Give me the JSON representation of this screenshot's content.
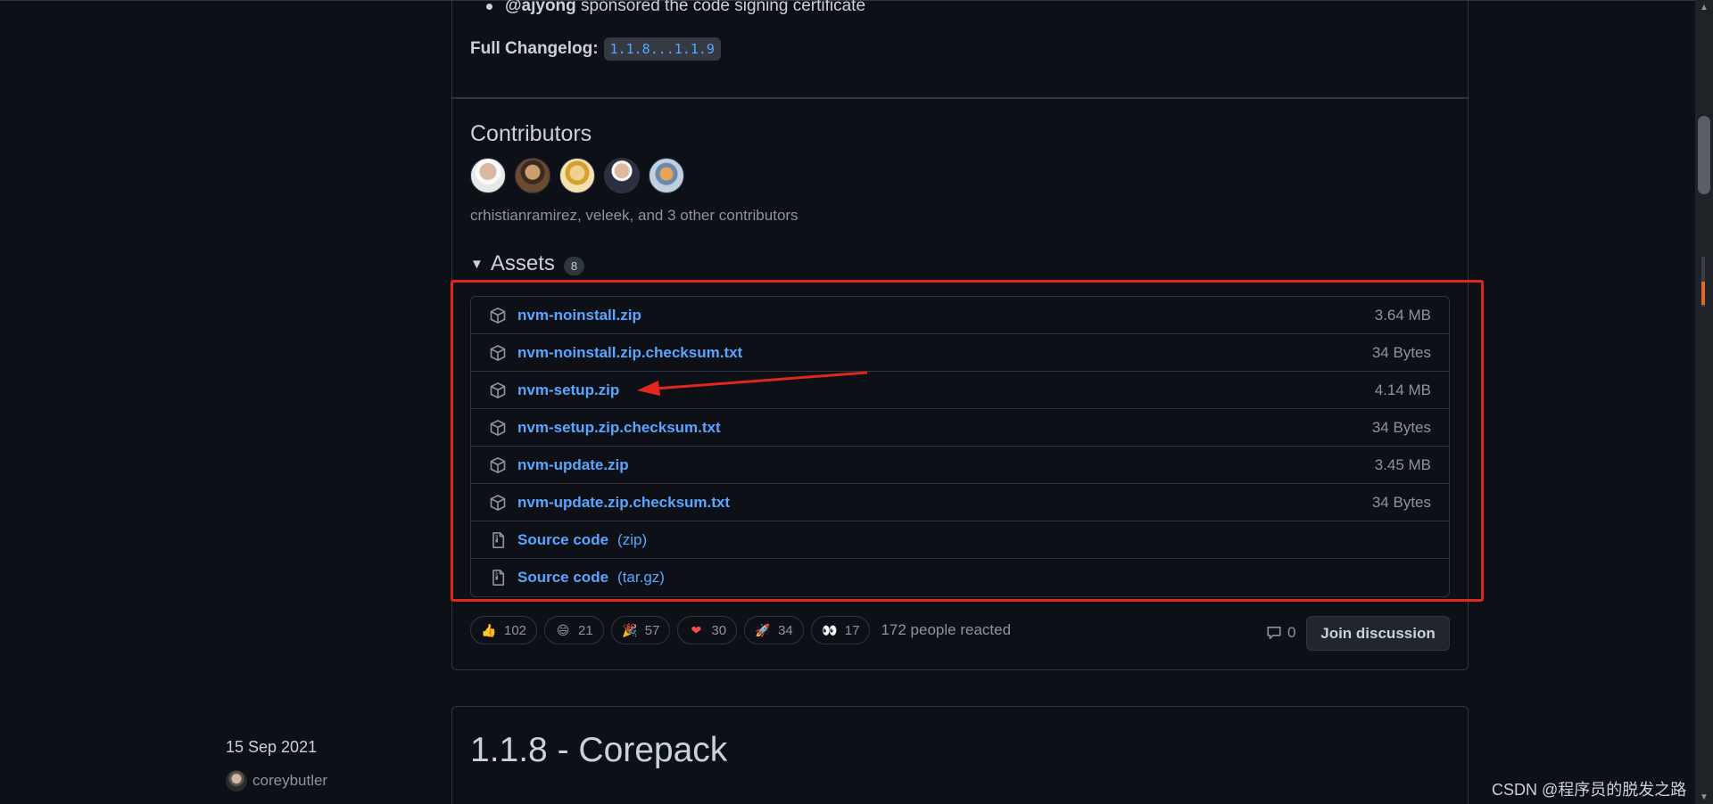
{
  "release_notes": {
    "bullet": {
      "user": "@ajyong",
      "text": "sponsored the code signing certificate"
    },
    "changelog": {
      "label": "Full Changelog:",
      "range": "1.1.8...1.1.9"
    }
  },
  "contributors": {
    "title": "Contributors",
    "summary": "crhistianramirez, veleek, and 3 other contributors"
  },
  "assets": {
    "title": "Assets",
    "count": "8",
    "files": [
      {
        "name": "nvm-noinstall.zip",
        "size": "3.64 MB"
      },
      {
        "name": "nvm-noinstall.zip.checksum.txt",
        "size": "34 Bytes"
      },
      {
        "name": "nvm-setup.zip",
        "size": "4.14 MB"
      },
      {
        "name": "nvm-setup.zip.checksum.txt",
        "size": "34 Bytes"
      },
      {
        "name": "nvm-update.zip",
        "size": "3.45 MB"
      },
      {
        "name": "nvm-update.zip.checksum.txt",
        "size": "34 Bytes"
      }
    ],
    "source": [
      {
        "name": "Source code",
        "ext": "(zip)"
      },
      {
        "name": "Source code",
        "ext": "(tar.gz)"
      }
    ]
  },
  "reactions": {
    "items": [
      {
        "emoji": "👍",
        "count": "102"
      },
      {
        "emoji": "😄",
        "count": "21"
      },
      {
        "emoji": "🎉",
        "count": "57"
      },
      {
        "emoji": "❤",
        "count": "30"
      },
      {
        "emoji": "🚀",
        "count": "34"
      },
      {
        "emoji": "👀",
        "count": "17"
      }
    ],
    "summary": "172 people reacted"
  },
  "discussion": {
    "comment_count": "0",
    "join_label": "Join discussion"
  },
  "next_release": {
    "date": "15 Sep 2021",
    "author": "coreybutler",
    "title": "1.1.8 - Corepack"
  },
  "watermark": "CSDN @程序员的脱发之路",
  "colors": {
    "background": "#0d1117",
    "link": "#58a6ff",
    "muted": "#8b949e",
    "border": "#30363d",
    "annotation": "#e1261c"
  }
}
